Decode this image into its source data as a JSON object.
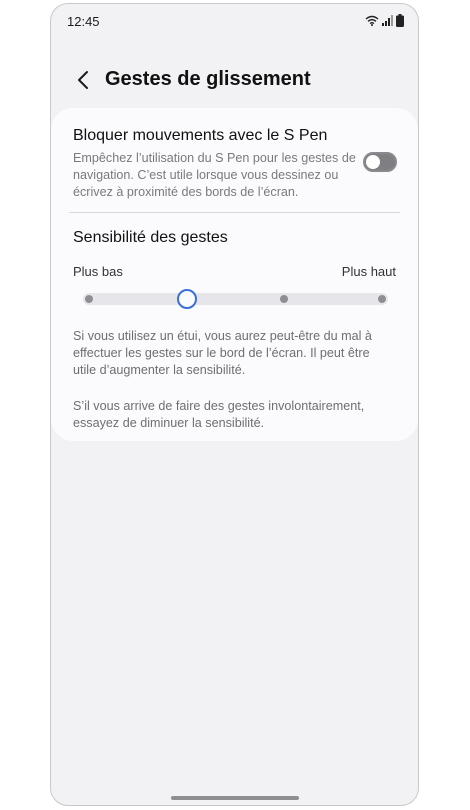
{
  "status_bar": {
    "time": "12:45",
    "icons": [
      "wifi-icon",
      "signal-icon",
      "battery-icon"
    ]
  },
  "header": {
    "back_icon": "chevron-left-icon",
    "title": "Gestes de glissement"
  },
  "settings": {
    "block_spen": {
      "title": "Bloquer mouvements avec le S Pen",
      "description": "Empêchez l’utilisation du S Pen pour les gestes de navigation. C’est utile lorsque vous dessinez ou écrivez à proximité des bords de l’écran.",
      "enabled": false
    },
    "sensitivity": {
      "title": "Sensibilité des gestes",
      "low_label": "Plus bas",
      "high_label": "Plus haut",
      "steps": 4,
      "selected_step": 2,
      "help_1": "Si vous utilisez un étui, vous aurez peut-être du mal à effectuer les gestes sur le bord de l’écran. Il peut être utile d’augmenter la sensibilité.",
      "help_2": "S’il vous arrive de faire des gestes involontairement, essayez de diminuer la sensibilité."
    }
  },
  "colors": {
    "background": "#f2f2f5",
    "card": "#fbfbfd",
    "accent": "#3a6fd8",
    "toggle_off": "#7f7f83"
  }
}
